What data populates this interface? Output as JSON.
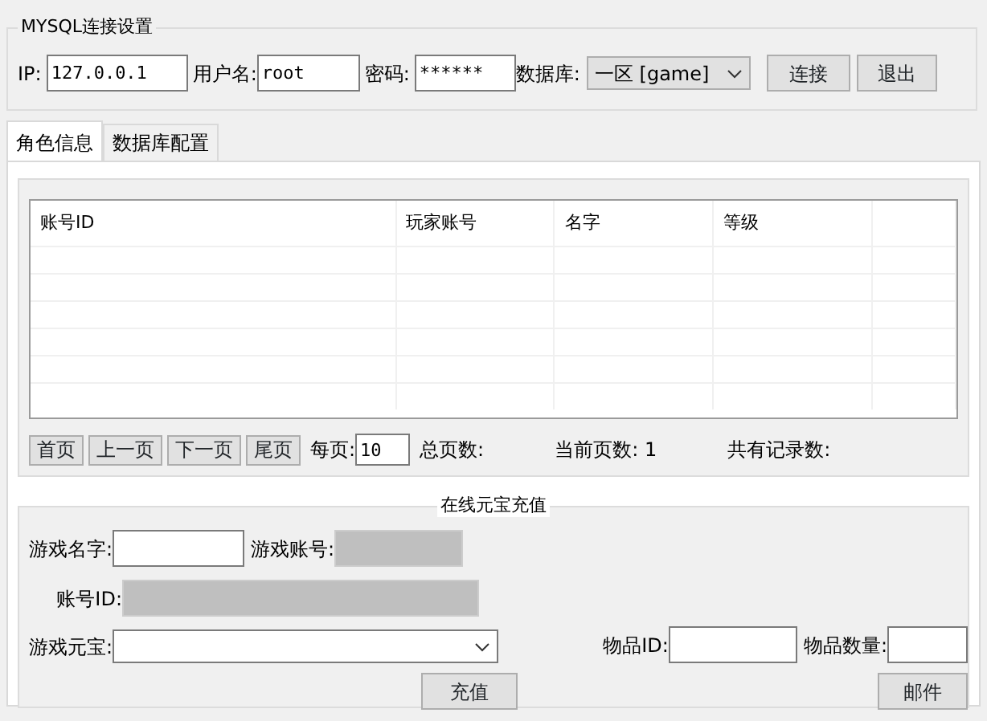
{
  "connection": {
    "title": "MYSQL连接设置",
    "ip_label": "IP:",
    "ip": "127.0.0.1",
    "user_label": "用户名:",
    "user": "root",
    "password_label": "密码:",
    "password": "******",
    "db_label": "数据库:",
    "db": "一区 [game]",
    "buttons": [
      "连接",
      "退出"
    ]
  },
  "tabs": [
    {
      "label": "角色信息",
      "selected": true
    },
    {
      "label": "数据库配置",
      "selected": false
    }
  ],
  "table": {
    "columns": [
      "账号ID",
      "玩家账号",
      "名字",
      "等级"
    ]
  },
  "pager": {
    "buttons": [
      "首页",
      "上一页",
      "下一页",
      "尾页"
    ],
    "per_page_label": "每页:",
    "per_page": "10",
    "total_pages_label": "总页数:",
    "current_page_label": "当前页数:",
    "current_page": "1",
    "records_label": "共有记录数:"
  },
  "recharge": {
    "title": "在线元宝充值",
    "name_field": {
      "label": "游戏名字:",
      "disabled": false
    },
    "account_field": {
      "label": "游戏账号:",
      "disabled": true
    },
    "id_field": {
      "label": "账号ID:",
      "disabled": true
    },
    "ingot_label": "游戏元宝:",
    "button": "充值",
    "item_id_label": "物品ID:",
    "item_qty_label": "物品数量:",
    "mail_button": "邮件"
  }
}
